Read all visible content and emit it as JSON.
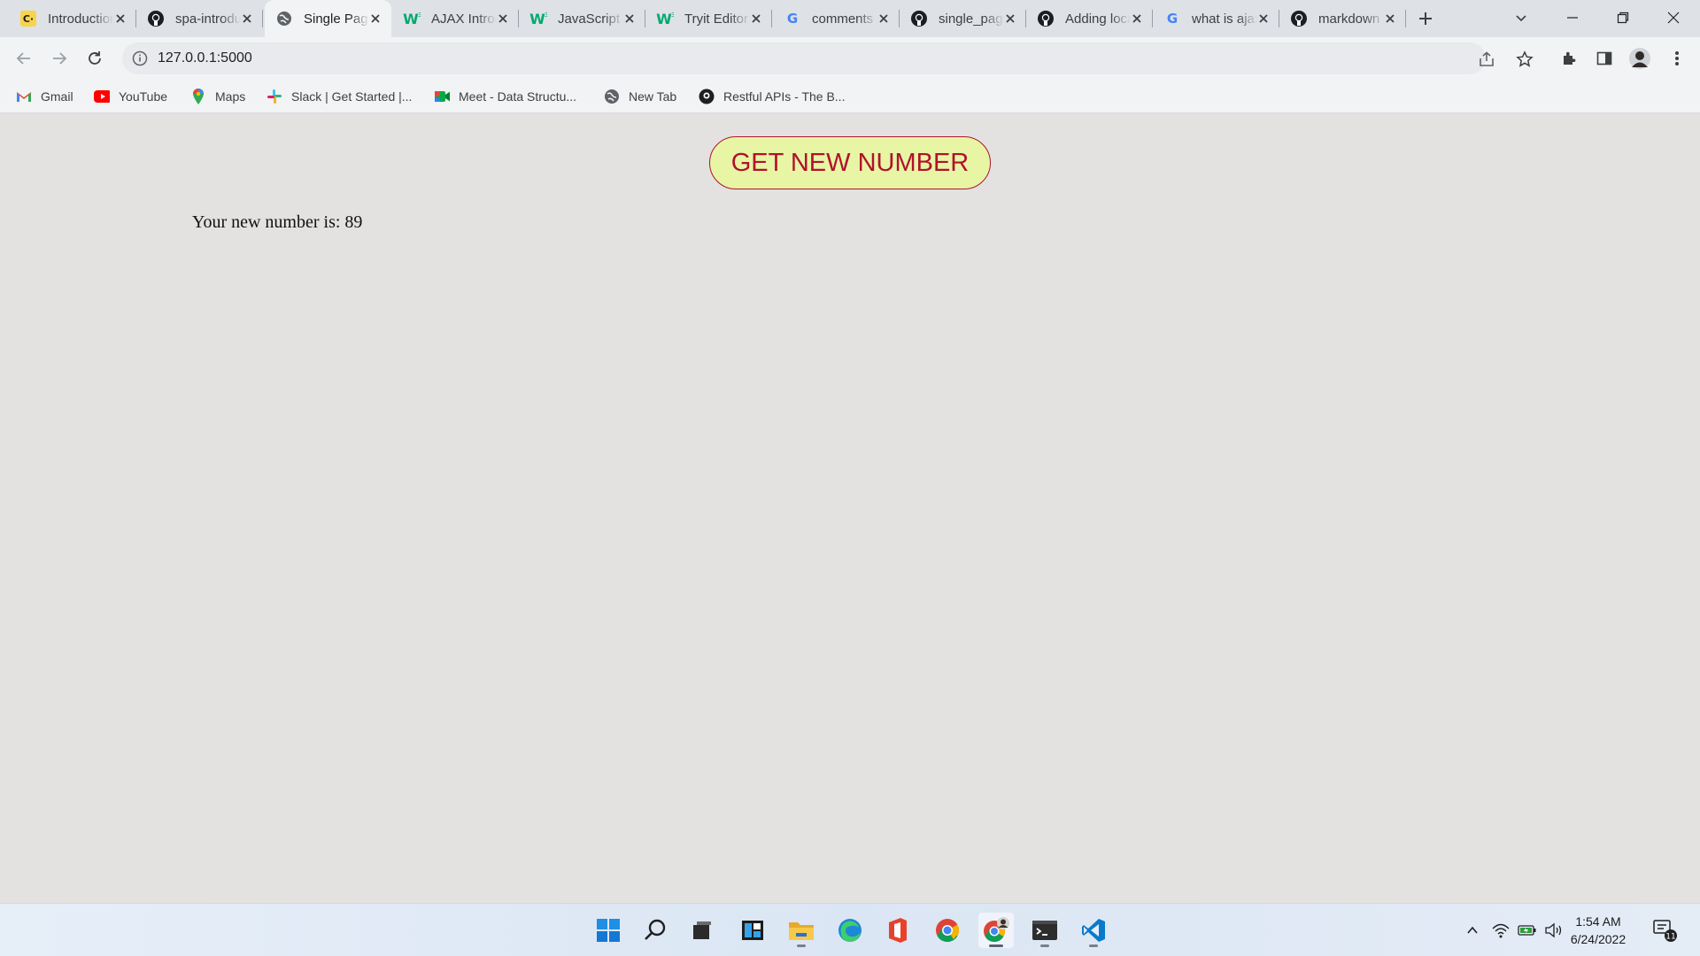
{
  "browser": {
    "tabs": [
      {
        "title": "Introduction to SPA",
        "favicon": "codecademy-icon",
        "active": false
      },
      {
        "title": "spa-introduction",
        "favicon": "github-icon",
        "active": false
      },
      {
        "title": "Single Page App",
        "favicon": "globe-icon",
        "active": true
      },
      {
        "title": "AJAX Introduction",
        "favicon": "w3schools-icon",
        "active": false
      },
      {
        "title": "JavaScript Fetch",
        "favicon": "w3schools-icon",
        "active": false
      },
      {
        "title": "Tryit Editor",
        "favicon": "w3schools-icon",
        "active": false
      },
      {
        "title": "comments in",
        "favicon": "google-icon",
        "active": false
      },
      {
        "title": "single_page_app",
        "favicon": "github-icon",
        "active": false
      },
      {
        "title": "Adding localhost",
        "favicon": "github-icon",
        "active": false
      },
      {
        "title": "what is ajax",
        "favicon": "google-icon",
        "active": false
      },
      {
        "title": "markdown",
        "favicon": "github-icon",
        "active": false
      }
    ],
    "url": "127.0.0.1:5000",
    "bookmarks": [
      {
        "label": "Gmail",
        "icon": "gmail-icon"
      },
      {
        "label": "YouTube",
        "icon": "youtube-icon"
      },
      {
        "label": "Maps",
        "icon": "maps-icon"
      },
      {
        "label": "Slack | Get Started |...",
        "icon": "slack-icon"
      },
      {
        "label": "Meet - Data Structu...",
        "icon": "meet-icon"
      },
      {
        "label": "New Tab",
        "icon": "globe-icon"
      },
      {
        "label": "Restful APIs - The B...",
        "icon": "restful-icon"
      }
    ]
  },
  "page": {
    "button_label": "GET NEW NUMBER",
    "result_text": "Your new number is: 89"
  },
  "taskbar": {
    "apps": [
      "windows-start-icon",
      "search-icon",
      "task-view-icon",
      "widgets-icon",
      "file-explorer-icon",
      "edge-icon",
      "office-icon",
      "chrome-icon",
      "chrome-profile-icon",
      "terminal-icon",
      "vscode-icon"
    ],
    "time": "1:54 AM",
    "date": "6/24/2022",
    "notification_count": "11"
  },
  "colors": {
    "button_bg": "#e8f5a4",
    "button_text": "#b0122c",
    "page_bg": "#e3e2e0"
  }
}
